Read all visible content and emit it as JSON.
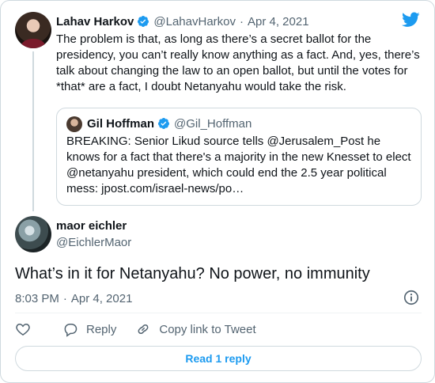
{
  "parent_tweet": {
    "author_name": "Lahav Harkov",
    "handle": "@LahavHarkov",
    "separator": "·",
    "date": "Apr 4, 2021",
    "text": "The problem is that, as long as there’s a secret ballot for the presidency, you can’t really know anything as a fact. And, yes, there’s talk about changing the law to an open ballot, but until the votes for *that* are a fact, I doubt Netanyahu would take the risk."
  },
  "quoted_tweet": {
    "author_name": "Gil Hoffman",
    "handle": "@Gil_Hoffman",
    "text": "BREAKING: Senior Likud source tells @Jerusalem_Post he knows for a fact that there's a majority in the new Knesset to elect @netanyahu president, which could end the 2.5 year political mess: jpost.com/israel-news/po…"
  },
  "reply_tweet": {
    "author_name": "maor eichler",
    "handle": "@EichlerMaor",
    "text": "What’s in it for Netanyahu? No power, no immunity",
    "time": "8:03 PM",
    "separator": "·",
    "date": "Apr 4, 2021"
  },
  "actions": {
    "reply_label": "Reply",
    "copy_link_label": "Copy link to Tweet"
  },
  "read_replies_label": "Read 1 reply",
  "icons": {
    "brand": "twitter-bird-icon",
    "verified": "verified-badge-icon",
    "info": "info-icon",
    "like": "heart-icon",
    "reply": "reply-bubble-icon",
    "copy_link": "link-icon"
  },
  "colors": {
    "accent": "#1d9bf0",
    "text": "#0f1419",
    "muted": "#536471",
    "border": "#cfd9de"
  }
}
